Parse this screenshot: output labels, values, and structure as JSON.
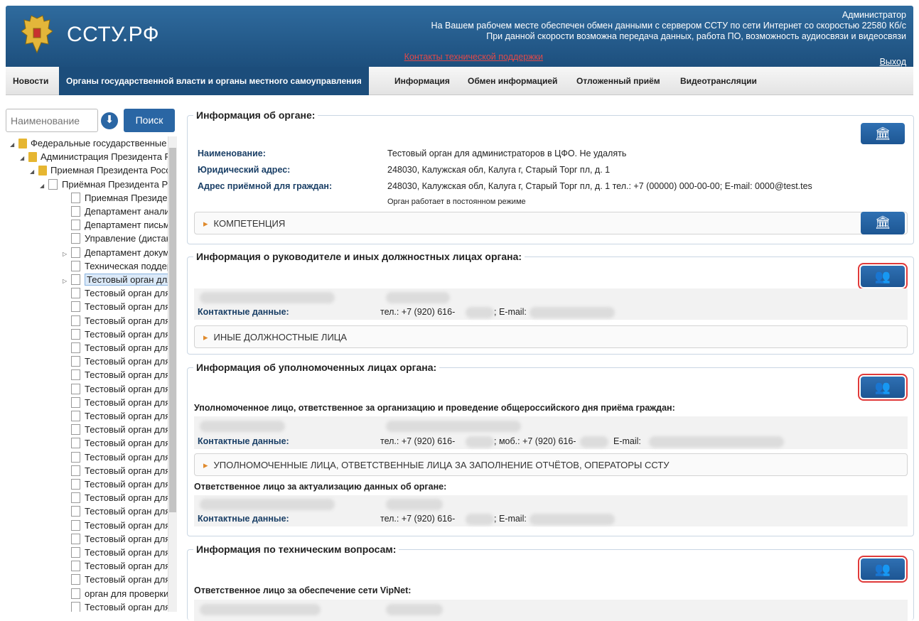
{
  "header": {
    "logo": "ССТУ.РФ",
    "user": "Администратор",
    "msg1": "На Вашем рабочем месте обеспечен обмен данными с сервером ССТУ по сети Интернет со скоростью 22580 Кб/с",
    "msg2": "При данной скорости возможна передача данных, работа ПО, возможность аудиосвязи и видеосвязи",
    "support": "Контакты технической поддержки",
    "exit": "Выход"
  },
  "nav": [
    "Новости",
    "Органы государственной власти и органы местного самоуправления",
    "Информация",
    "Обмен информацией",
    "Отложенный приём",
    "Видеотрансляции"
  ],
  "search": {
    "placeholder": "Наименование",
    "button": "Поиск"
  },
  "tree": [
    {
      "label": "Федеральные государственные органы",
      "level": 0,
      "type": "folder",
      "arrow": "◢"
    },
    {
      "label": "Администрация Президента Российской Федерации",
      "level": 1,
      "type": "folder",
      "arrow": "◢"
    },
    {
      "label": "Приемная Президента Российской Федерации",
      "level": 2,
      "type": "folder",
      "arrow": "◢"
    },
    {
      "label": "Приёмная Президента Российской Федерации",
      "level": 3,
      "type": "page",
      "arrow": "◢"
    },
    {
      "label": "Приемная Президента",
      "level": 4,
      "type": "page",
      "arrow": ""
    },
    {
      "label": "Департамент анализа",
      "level": 4,
      "type": "page",
      "arrow": ""
    },
    {
      "label": "Департамент письменных",
      "level": 4,
      "type": "page",
      "arrow": ""
    },
    {
      "label": "Управление (дистанционное)",
      "level": 4,
      "type": "page",
      "arrow": ""
    },
    {
      "label": "Департамент документального",
      "level": 4,
      "type": "page",
      "arrow": "▷"
    },
    {
      "label": "Техническая поддержка",
      "level": 4,
      "type": "page",
      "arrow": ""
    },
    {
      "label": "Тестовый орган для администраторов",
      "level": 4,
      "type": "page",
      "arrow": "▷",
      "selected": true
    },
    {
      "label": "Тестовый орган для администраторов",
      "level": 4,
      "type": "page",
      "arrow": ""
    },
    {
      "label": "Тестовый орган для администраторов",
      "level": 4,
      "type": "page",
      "arrow": ""
    },
    {
      "label": "Тестовый орган для администраторов",
      "level": 4,
      "type": "page",
      "arrow": ""
    },
    {
      "label": "Тестовый орган для администраторов",
      "level": 4,
      "type": "page",
      "arrow": ""
    },
    {
      "label": "Тестовый орган для администраторов",
      "level": 4,
      "type": "page",
      "arrow": ""
    },
    {
      "label": "Тестовый орган для администраторов",
      "level": 4,
      "type": "page",
      "arrow": ""
    },
    {
      "label": "Тестовый орган для администраторов",
      "level": 4,
      "type": "page",
      "arrow": ""
    },
    {
      "label": "Тестовый орган для администраторов",
      "level": 4,
      "type": "page",
      "arrow": ""
    },
    {
      "label": "Тестовый орган для администраторов",
      "level": 4,
      "type": "page",
      "arrow": ""
    },
    {
      "label": "Тестовый орган для администраторов",
      "level": 4,
      "type": "page",
      "arrow": ""
    },
    {
      "label": "Тестовый орган для администраторов",
      "level": 4,
      "type": "page",
      "arrow": ""
    },
    {
      "label": "Тестовый орган для администраторов",
      "level": 4,
      "type": "page",
      "arrow": ""
    },
    {
      "label": "Тестовый орган для администраторов",
      "level": 4,
      "type": "page",
      "arrow": ""
    },
    {
      "label": "Тестовый орган для администраторов",
      "level": 4,
      "type": "page",
      "arrow": ""
    },
    {
      "label": "Тестовый орган для администраторов",
      "level": 4,
      "type": "page",
      "arrow": ""
    },
    {
      "label": "Тестовый орган для администраторов",
      "level": 4,
      "type": "page",
      "arrow": ""
    },
    {
      "label": "Тестовый орган для администраторов",
      "level": 4,
      "type": "page",
      "arrow": ""
    },
    {
      "label": "Тестовый орган для администраторов",
      "level": 4,
      "type": "page",
      "arrow": ""
    },
    {
      "label": "Тестовый орган для администраторов",
      "level": 4,
      "type": "page",
      "arrow": ""
    },
    {
      "label": "Тестовый орган для администраторов",
      "level": 4,
      "type": "page",
      "arrow": ""
    },
    {
      "label": "Тестовый орган для администраторов",
      "level": 4,
      "type": "page",
      "arrow": ""
    },
    {
      "label": "Тестовый орган для администраторов",
      "level": 4,
      "type": "page",
      "arrow": ""
    },
    {
      "label": "орган для проверки",
      "level": 4,
      "type": "page",
      "arrow": ""
    },
    {
      "label": "Тестовый орган для администраторов",
      "level": 4,
      "type": "page",
      "arrow": ""
    }
  ],
  "organ": {
    "title": "Информация об органе:",
    "name_label": "Наименование:",
    "name": "Тестовый орган для администраторов в ЦФО. Не удалять",
    "addr_label": "Юридический адрес:",
    "addr": "248030, Калужская обл, Калуга г, Старый Торг пл, д. 1",
    "reception_label": "Адрес приёмной для граждан:",
    "reception": "248030, Калужская обл, Калуга г, Старый Торг пл, д. 1 тел.: +7 (00000) 000-00-00; E-mail: 0000@test.tes",
    "mode": "Орган работает в постоянном режиме",
    "competence": "КОМПЕТЕНЦИЯ"
  },
  "head": {
    "title": "Информация о руководителе и иных должностных лицах органа:",
    "contact_label": "Контактные данные:",
    "phone": "тел.: +7 (920) 616-",
    "email": "; E-mail:",
    "other": "ИНЫЕ ДОЛЖНОСТНЫЕ ЛИЦА"
  },
  "auth": {
    "title": "Информация об уполномоченных лицах органа:",
    "sub1": "Уполномоченное лицо, ответственное за организацию и проведение общероссийского дня приёма граждан:",
    "contact_label": "Контактные данные:",
    "phone": "тел.: +7 (920) 616-",
    "mob": "; моб.: +7 (920) 616-",
    "email": "E-mail:",
    "acc": "УПОЛНОМОЧЕННЫЕ ЛИЦА, ОТВЕТСТВЕННЫЕ ЛИЦА ЗА ЗАПОЛНЕНИЕ ОТЧЁТОВ, ОПЕРАТОРЫ ССТУ",
    "sub2": "Ответственное лицо за актуализацию данных об органе:",
    "contact_label2": "Контактные данные:",
    "phone2": "тел.: +7 (920) 616-",
    "email2": "; E-mail:"
  },
  "tech": {
    "title": "Информация по техническим вопросам:",
    "sub": "Ответственное лицо за обеспечение сети VipNet:"
  },
  "icons": {
    "building": "🏛",
    "users": "👥",
    "edit": "✎"
  }
}
